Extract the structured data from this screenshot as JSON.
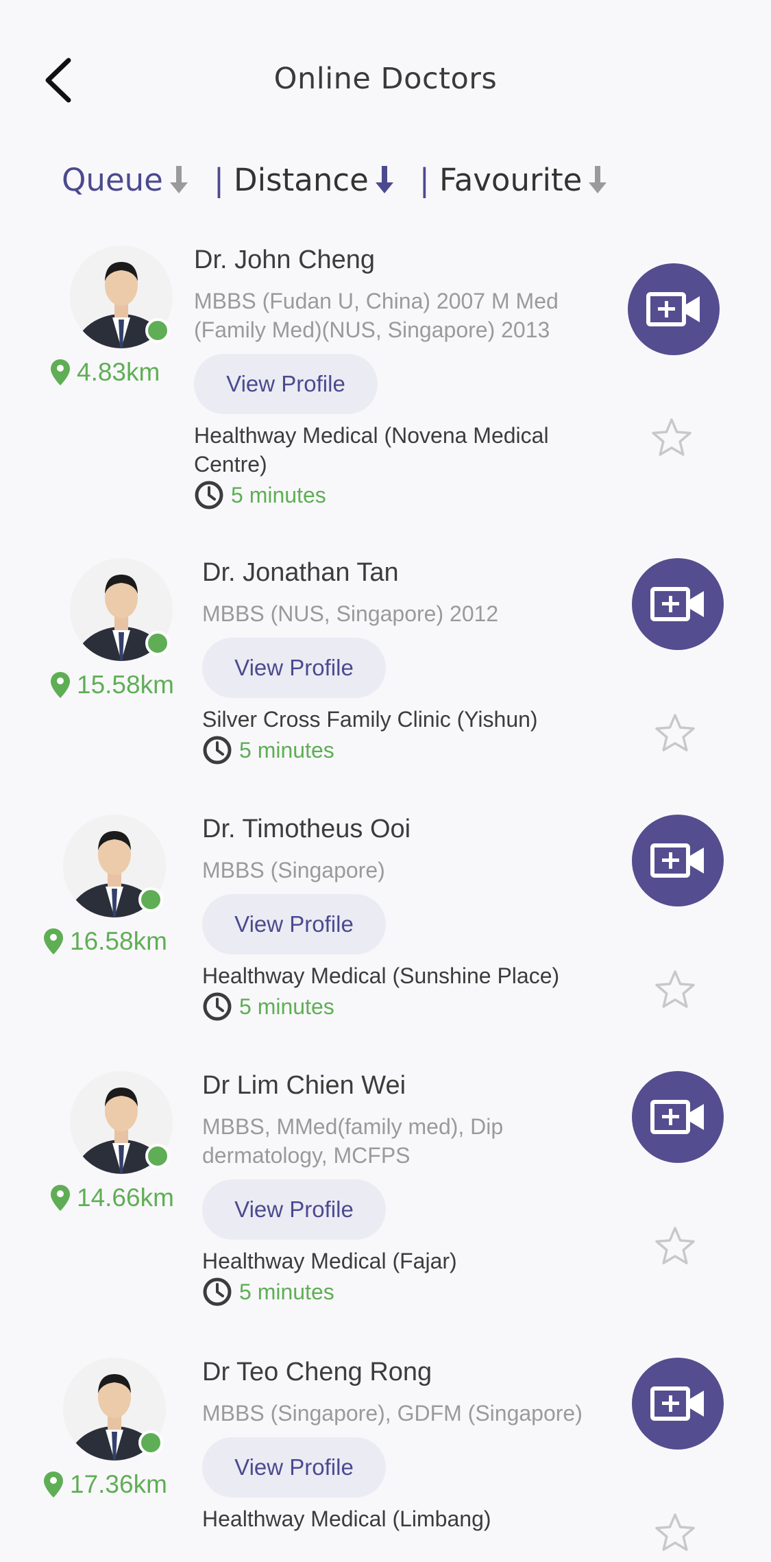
{
  "header": {
    "title": "Online Doctors"
  },
  "sort": [
    {
      "label": "Queue"
    },
    {
      "label": "Distance"
    },
    {
      "label": "Favourite"
    }
  ],
  "colors": {
    "accent": "#544d8f",
    "green": "#5fae55"
  },
  "doctors": [
    {
      "name": "Dr. John Cheng",
      "quals": "MBBS (Fudan U, China) 2007 M Med (Family Med)(NUS, Singapore) 2013",
      "distance": "4.83km",
      "view_profile": "View Profile",
      "clinic": "Healthway Medical (Novena Medical Centre)",
      "wait": "5 minutes"
    },
    {
      "name": "Dr. Jonathan Tan",
      "quals": "MBBS (NUS, Singapore) 2012",
      "distance": "15.58km",
      "view_profile": "View Profile",
      "clinic": "Silver Cross Family Clinic (Yishun)",
      "wait": "5 minutes"
    },
    {
      "name": "Dr. Timotheus Ooi",
      "quals": "MBBS (Singapore)",
      "distance": "16.58km",
      "view_profile": "View Profile",
      "clinic": "Healthway Medical (Sunshine Place)",
      "wait": "5 minutes"
    },
    {
      "name": "Dr Lim Chien Wei",
      "quals": "MBBS, MMed(family med), Dip dermatology, MCFPS",
      "distance": "14.66km",
      "view_profile": "View Profile",
      "clinic": "Healthway Medical (Fajar)",
      "wait": "5 minutes"
    },
    {
      "name": "Dr Teo Cheng Rong",
      "quals": "MBBS (Singapore), GDFM (Singapore)",
      "distance": "17.36km",
      "view_profile": "View Profile",
      "clinic": "Healthway Medical (Limbang)",
      "wait": ""
    }
  ]
}
